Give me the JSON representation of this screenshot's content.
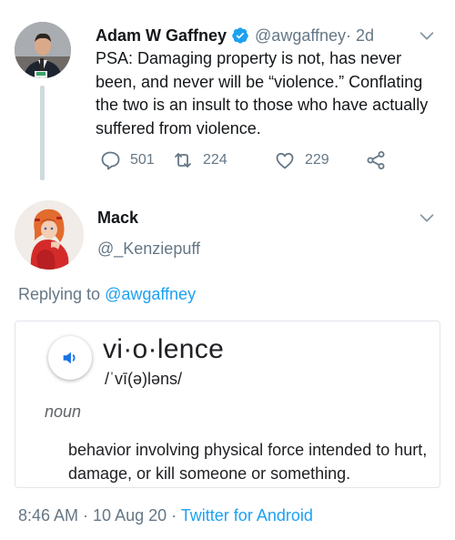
{
  "parent_tweet": {
    "author_name": "Adam W Gaffney",
    "verified_icon": "verified-badge-icon",
    "handle": "@awgaffney",
    "time": " · 2d",
    "text": "PSA: Damaging property is not, has never been, and never will be “violence.”  Conflating the two is an insult to those who have actually suffered from violence.",
    "reply_count": "501",
    "retweet_count": "224",
    "like_count": "229"
  },
  "reply_tweet": {
    "author_name": "Mack",
    "handle": "@_Kenziepuff",
    "replying_prefix": "Replying to ",
    "replying_to": "@awgaffney",
    "definition_card": {
      "word": "vi·o·lence",
      "phonetic": "/ˈvī(ə)ləns/",
      "part_of_speech": "noun",
      "definition": "behavior involving physical force intended to hurt, damage, or kill someone or something."
    },
    "timestamp": "8:46 AM · 10 Aug 20 · ",
    "source": "Twitter for Android"
  },
  "colors": {
    "accent": "#1da1f2",
    "secondary_text": "#657786",
    "primary_text": "#14171a"
  }
}
